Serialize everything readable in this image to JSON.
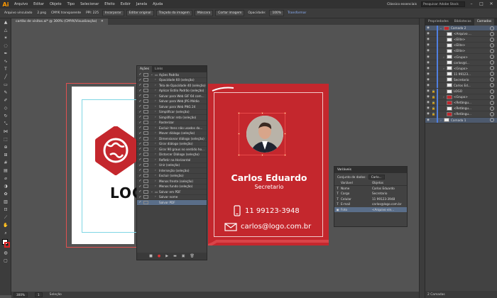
{
  "app": {
    "logo": "Ai",
    "menu": [
      "Arquivo",
      "Editar",
      "Objeto",
      "Tipo",
      "Selecionar",
      "Efeito",
      "Exibir",
      "Janela",
      "Ajuda"
    ],
    "workspace": "Clássico essenciais",
    "search_placeholder": "Pesquisar Adobe Stock"
  },
  "controlbar": {
    "label": "Arquivo vinculado",
    "file": "2.png",
    "mode": "CMYK transparente",
    "ppi": "PPI: 225",
    "embed": "Incorporar",
    "edit_original": "Editar original",
    "trace": "Traçado da imagem",
    "mask": "Máscara",
    "crop": "Cortar imagem",
    "opacity_label": "Opacidade:",
    "opacity": "100%",
    "transform": "Transformar"
  },
  "document": {
    "tab": "cartão de visitas.ai* @ 300% (CMYK/Visualização)"
  },
  "statusbar": {
    "zoom": "300%",
    "page": "1",
    "tool": "Seleção"
  },
  "card": {
    "name": "Carlos Eduardo",
    "role": "Secretario",
    "phone": "11 99123-3948",
    "email": "carlos@logo.com.br",
    "bg_color": "#c4272d"
  },
  "artboard_logo": {
    "word": "LOGO"
  },
  "actions_panel": {
    "tabs": [
      "Ações",
      "Links"
    ],
    "rows": [
      {
        "label": "Ações Padrão",
        "level": 0,
        "check": true,
        "chev": "v",
        "folder": true
      },
      {
        "label": "Opacidade 60 (seleção)",
        "level": 1,
        "check": true,
        "chev": ">"
      },
      {
        "label": "Tela de Opacidade 40 (seleção)",
        "level": 1,
        "check": true,
        "chev": ">"
      },
      {
        "label": "Aplicar Estilo Padrão (seleção)",
        "level": 1,
        "check": true,
        "chev": ">"
      },
      {
        "label": "Salvar para Web GIF 64 com...",
        "level": 1,
        "check": true,
        "chev": ">"
      },
      {
        "label": "Salvar para Web JPG Médio",
        "level": 1,
        "check": true,
        "chev": ">"
      },
      {
        "label": "Salvar para Web PNG 24",
        "level": 1,
        "check": true,
        "chev": ">"
      },
      {
        "label": "Simplificar (seleção)",
        "level": 1,
        "check": true,
        "chev": ">"
      },
      {
        "label": "Simplificar reta (seleção)",
        "level": 1,
        "check": true,
        "chev": ">"
      },
      {
        "label": "Rasterizar",
        "level": 1,
        "check": true,
        "chev": ">"
      },
      {
        "label": "Excluir Itens não usados do...",
        "level": 1,
        "check": true,
        "chev": ">"
      },
      {
        "label": "Mover diálogo (seleção)",
        "level": 1,
        "check": true,
        "chev": ">"
      },
      {
        "label": "Dimensionar diálogo (seleção)",
        "level": 1,
        "check": true,
        "chev": ">"
      },
      {
        "label": "Girar diálogo (seleção)",
        "level": 1,
        "check": true,
        "chev": ">"
      },
      {
        "label": "Girar 90 graus no sentido ho...",
        "level": 1,
        "check": true,
        "chev": ">"
      },
      {
        "label": "Distorcer Diálogo (seleção)",
        "level": 1,
        "check": true,
        "chev": ">"
      },
      {
        "label": "Refletir na Horizontal",
        "level": 1,
        "check": true,
        "chev": ">"
      },
      {
        "label": "Unir (seleção)",
        "level": 1,
        "check": true,
        "chev": ">"
      },
      {
        "label": "Interseção (seleção)",
        "level": 1,
        "check": true,
        "chev": ">"
      },
      {
        "label": "Excluir (seleção)",
        "level": 1,
        "check": true,
        "chev": ">"
      },
      {
        "label": "Menos frente (seleção)",
        "level": 1,
        "check": true,
        "chev": ">"
      },
      {
        "label": "Menos fundo (seleção)",
        "level": 1,
        "check": true,
        "chev": ">"
      },
      {
        "label": "Salvar em PDF",
        "level": 0,
        "check": true,
        "chev": "v",
        "folder": true
      },
      {
        "label": "Salvar nome",
        "level": 1,
        "check": true,
        "chev": ">"
      },
      {
        "label": "Salvar PDF",
        "level": 1,
        "check": true,
        "chev": "",
        "selected": true
      }
    ]
  },
  "variables_panel": {
    "title": "Variáveis",
    "dataset_label": "Conjunto de dados:",
    "dataset_value": "Carlo...",
    "headers": [
      "Variável",
      "Objetos"
    ],
    "rows": [
      {
        "type": "T",
        "name": "Nome",
        "object": "Carlos Eduardo"
      },
      {
        "type": "T",
        "name": "Cargo",
        "object": "Secretario"
      },
      {
        "type": "T",
        "name": "Celular",
        "object": "11 99123-3948"
      },
      {
        "type": "T",
        "name": "E-mail",
        "object": "carlos@logo.com.br"
      },
      {
        "type": "▣",
        "name": "Foto",
        "object": "<Arquivo vin...",
        "selected": true
      }
    ]
  },
  "layers_panel": {
    "tabs": [
      "Propriedades",
      "Bibliotecas",
      "Camadas"
    ],
    "rows": [
      {
        "label": "Camada 2",
        "eye": true,
        "lock": false,
        "chev": "v",
        "thumb": "red",
        "top": true
      },
      {
        "label": "<Arquivo ...",
        "eye": true,
        "lock": false,
        "chev": "",
        "thumb": "white"
      },
      {
        "label": "<Elite>",
        "eye": true,
        "lock": false,
        "chev": "",
        "thumb": "white"
      },
      {
        "label": "<Elite>",
        "eye": true,
        "lock": false,
        "chev": "",
        "thumb": "white"
      },
      {
        "label": "<Elite>",
        "eye": true,
        "lock": false,
        "chev": "",
        "thumb": "white"
      },
      {
        "label": "<Grupo>",
        "eye": true,
        "lock": false,
        "chev": ">",
        "thumb": "white"
      },
      {
        "label": "carlos@l...",
        "eye": true,
        "lock": false,
        "chev": "",
        "thumb": "white"
      },
      {
        "label": "<Grupo>",
        "eye": true,
        "lock": false,
        "chev": ">",
        "thumb": "white"
      },
      {
        "label": "11 99123...",
        "eye": true,
        "lock": false,
        "chev": "",
        "thumb": "white"
      },
      {
        "label": "Secretario",
        "eye": true,
        "lock": false,
        "chev": "",
        "thumb": "white"
      },
      {
        "label": "Carlos Ed...",
        "eye": true,
        "lock": false,
        "chev": "",
        "thumb": "white"
      },
      {
        "label": "LOGO",
        "eye": true,
        "lock": true,
        "chev": "",
        "thumb": "white"
      },
      {
        "label": "<Grupo>",
        "eye": true,
        "lock": true,
        "chev": ">",
        "thumb": "red"
      },
      {
        "label": "<Retângu...",
        "eye": true,
        "lock": true,
        "chev": "",
        "thumb": "red"
      },
      {
        "label": "<Retângu...",
        "eye": true,
        "lock": true,
        "chev": "",
        "thumb": "white"
      },
      {
        "label": "<Retângu...",
        "eye": true,
        "lock": true,
        "chev": "",
        "thumb": "red"
      },
      {
        "label": "Camada 1",
        "eye": true,
        "lock": false,
        "chev": ">",
        "thumb": "white",
        "top": true
      }
    ],
    "footer": "2 Camadas"
  }
}
